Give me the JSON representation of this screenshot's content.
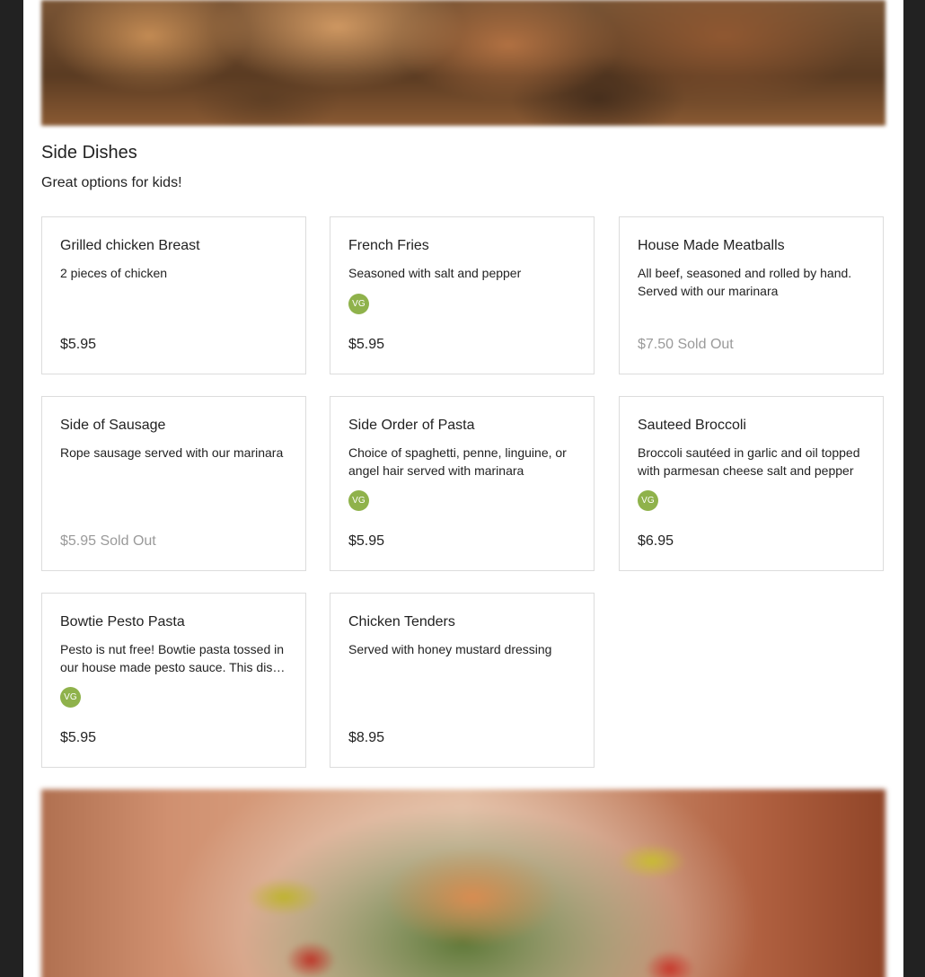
{
  "section": {
    "title": "Side Dishes",
    "subtitle": "Great options for kids!"
  },
  "items": [
    {
      "name": "Grilled chicken Breast",
      "description": "2 pieces of chicken",
      "badge": "",
      "price": "$5.95"
    },
    {
      "name": "French Fries",
      "description": "Seasoned with salt and pepper",
      "badge": "VG",
      "price": "$5.95"
    },
    {
      "name": "House Made Meatballs",
      "description": "All beef, seasoned and rolled by hand. Served with our marinara",
      "badge": "",
      "price": "$7.50 Sold Out"
    },
    {
      "name": "Side of Sausage",
      "description": "Rope sausage served with our marinara",
      "badge": "",
      "price": "$5.95 Sold Out"
    },
    {
      "name": "Side Order of Pasta",
      "description": "Choice of spaghetti, penne, linguine, or angel hair served with marinara",
      "badge": "VG",
      "price": "$5.95"
    },
    {
      "name": "Sauteed Broccoli",
      "description": "Broccoli sautéed in garlic and oil topped with parmesan cheese salt and pepper",
      "badge": "VG",
      "price": "$6.95"
    },
    {
      "name": "Bowtie Pesto Pasta",
      "description": "Pesto is nut free! Bowtie pasta tossed in our house made pesto sauce. This dish is vegetarian.",
      "badge": "VG",
      "price": "$5.95"
    },
    {
      "name": "Chicken Tenders",
      "description": "Served with honey mustard dressing",
      "badge": "",
      "price": "$8.95"
    }
  ],
  "colors": {
    "vegetarian_badge": "#8fb24b",
    "sold_out_text": "#9a9a9a"
  }
}
